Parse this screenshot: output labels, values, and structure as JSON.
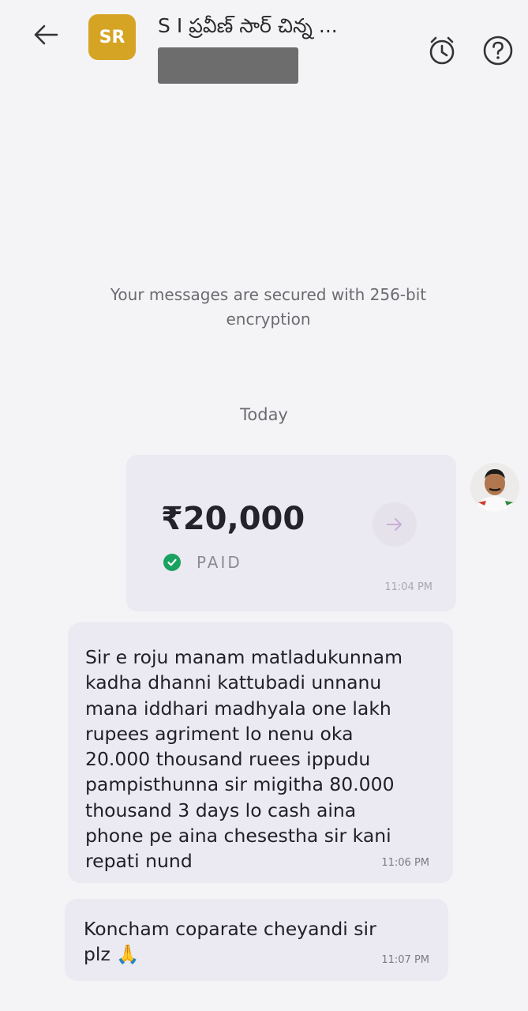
{
  "header": {
    "avatar_initials": "SR",
    "contact_name": "S I ప్రవీణ్ సార్ చిన్న ...",
    "avatar_color": "#d6a424"
  },
  "chat": {
    "security_note": "Your messages are secured with 256-bit encryption",
    "date_separator": "Today"
  },
  "payment": {
    "amount": "₹20,000",
    "status": "PAID",
    "time": "11:04 PM",
    "status_color": "#1aa260"
  },
  "messages": [
    {
      "lines": [
        "Sir e roju manam matladukunnam",
        "kadha dhanni kattubadi unnanu",
        "mana iddhari madhyala one lakh",
        "rupees agriment lo nenu oka",
        "20.000 thousand ruees ippudu",
        "pampisthunna sir migitha 80.000",
        "thousand 3 days lo cash aina",
        "phone pe aina chesestha sir kani",
        "repati nund"
      ],
      "time": "11:06 PM"
    },
    {
      "lines": [
        "Koncham coparate cheyandi sir",
        "plz 🙏"
      ],
      "time": "11:07 PM"
    }
  ],
  "icons": {
    "back": "arrow-left-icon",
    "alarm": "alarm-clock-icon",
    "help": "question-mark-icon",
    "paid": "check-circle-icon",
    "payment_arrow": "arrow-right-icon"
  }
}
